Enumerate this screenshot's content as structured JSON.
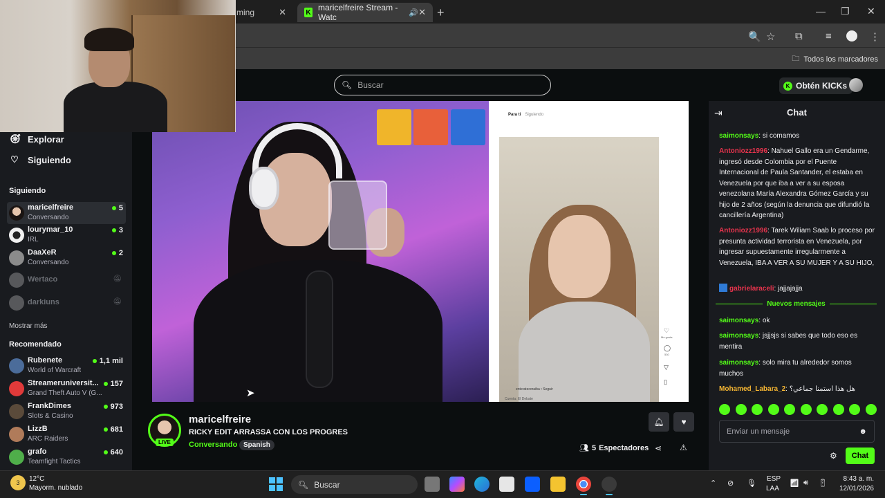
{
  "browser": {
    "tabs": [
      {
        "label": "ming",
        "active": false
      },
      {
        "label": "maricelfreire Stream - Watc",
        "active": true
      }
    ],
    "bookmarks_label": "Todos los marcadores"
  },
  "kick": {
    "search_placeholder": "Buscar",
    "kicks_button": "Obtén KICKs",
    "accent": "#53fc18"
  },
  "sidebar": {
    "nav": [
      {
        "label": "Explorar",
        "icon": "compass-icon"
      },
      {
        "label": "Siguiendo",
        "icon": "heart-icon"
      }
    ],
    "following_title": "Siguiendo",
    "following": [
      {
        "name": "maricelfreire",
        "sub": "Conversando",
        "viewers": "5",
        "live": true
      },
      {
        "name": "lourymar_10",
        "sub": "IRL",
        "viewers": "3",
        "live": true
      },
      {
        "name": "DaaXeR",
        "sub": "Conversando",
        "viewers": "2",
        "live": true
      },
      {
        "name": "Wertaco",
        "sub": "",
        "viewers": "",
        "live": false
      },
      {
        "name": "darkiuns",
        "sub": "",
        "viewers": "",
        "live": false
      }
    ],
    "show_more": "Mostrar más",
    "recommended_title": "Recomendado",
    "recommended": [
      {
        "name": "Rubenete",
        "sub": "World of Warcraft",
        "viewers": "1,1 mil"
      },
      {
        "name": "Streameruniversit...",
        "sub": "Grand Theft Auto V (G...",
        "viewers": "157"
      },
      {
        "name": "FrankDimes",
        "sub": "Slots & Casino",
        "viewers": "973"
      },
      {
        "name": "LizzB",
        "sub": "ARC Raiders",
        "viewers": "681"
      },
      {
        "name": "grafo",
        "sub": "Teamfight Tactics",
        "viewers": "640"
      }
    ]
  },
  "video": {
    "tiktok_tab_active": "Para ti",
    "tiktok_tab": "Siguiendo",
    "tiktok_user": "enteratecoraiba • Seguir",
    "tiktok_like": "Me gusta",
    "tiktok_comments": "530",
    "tiktok_footer": "Cuenta: El Debate"
  },
  "stream": {
    "streamer": "maricelfreire",
    "live_badge": "LIVE",
    "title": "RICKY EDIT ARRASSA CON LOS PROGRES",
    "category": "Conversando",
    "language": "Spanish",
    "viewers_count": "5",
    "viewers_label": "Espectadores"
  },
  "chat": {
    "title": "Chat",
    "messages": [
      {
        "user": "saimonsays",
        "color": "#53fc18",
        "text": "si comamos"
      },
      {
        "user": "Antoniozz1996",
        "color": "#e8344d",
        "text": "Nahuel Gallo era un Gendarme, ingresó desde Colombia por el Puente Internacional de Paula Santander, el estaba en Venezuela por que iba a ver a su esposa venezolana María Alexandra Gómez García y su hijo de 2 años (según la denuncia que difundió la cancillería Argentina)"
      },
      {
        "user": "Antoniozz1996",
        "color": "#e8344d",
        "text": "Tarek Wiliam Saab lo proceso por presunta actividad terrorista en Venezuela, por ingresar supuestamente irregularmente a Venezuela, IBA A VER A SU MUJER Y A SU HIJO,"
      },
      {
        "user": "gabrielaraceli",
        "color": "#e8344d",
        "text": "jajjajajja"
      }
    ],
    "new_messages_label": "Nuevos mensajes",
    "new_messages": [
      {
        "user": "saimonsays",
        "color": "#53fc18",
        "text": "ok"
      },
      {
        "user": "saimonsays",
        "color": "#53fc18",
        "text": "jsjjsjs si sabes que todo eso es mentira"
      },
      {
        "user": "saimonsays",
        "color": "#53fc18",
        "text": "solo mira tu alrededor somos muchos"
      },
      {
        "user": "Mohamed_Labara_2",
        "color": "#f7b733",
        "text": "هل هذا استمنا جماعي؟"
      }
    ],
    "input_placeholder": "Enviar un mensaje",
    "send_label": "Chat"
  },
  "taskbar": {
    "weather_temp": "12°C",
    "weather_desc": "Mayorm. nublado",
    "weather_badge": "3",
    "search_label": "Buscar",
    "lang_top": "ESP",
    "lang_bottom": "LAA",
    "time": "8:43 a. m.",
    "date": "12/01/2026"
  }
}
